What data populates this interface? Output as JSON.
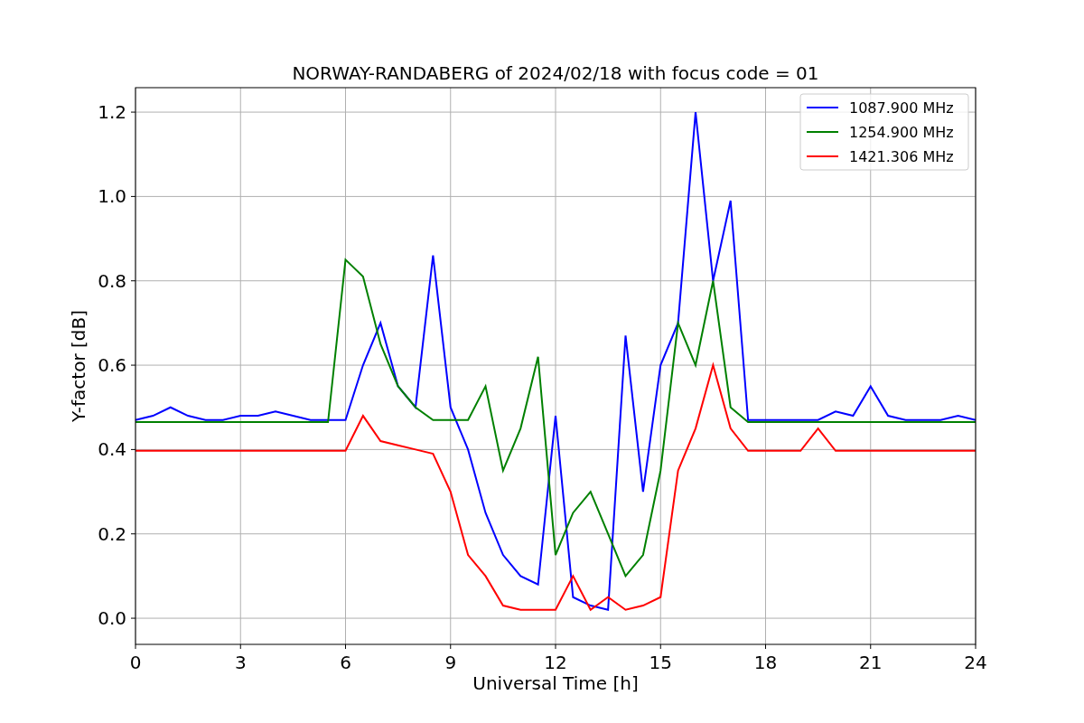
{
  "figure": {
    "chart_data": {
      "type": "line",
      "title": "NORWAY-RANDABERG of 2024/02/18 with focus code = 01",
      "xlabel": "Universal Time [h]",
      "ylabel": "Y-factor [dB]",
      "x": [
        0,
        0.5,
        1,
        1.5,
        2,
        2.5,
        3,
        3.5,
        4,
        4.5,
        5,
        5.5,
        6,
        6.5,
        7,
        7.5,
        8,
        8.5,
        9,
        9.5,
        10,
        10.5,
        11,
        11.5,
        12,
        12.5,
        13,
        13.5,
        14,
        14.5,
        15,
        15.5,
        16,
        16.5,
        17,
        17.5,
        18,
        18.5,
        19,
        19.5,
        20,
        20.5,
        21,
        21.5,
        22,
        22.5,
        23,
        23.5,
        24
      ],
      "series": [
        {
          "name": "1087.900 MHz",
          "color": "#0000ff",
          "values": [
            0.47,
            0.48,
            0.5,
            0.48,
            0.47,
            0.47,
            0.48,
            0.48,
            0.49,
            0.48,
            0.47,
            0.47,
            0.47,
            0.6,
            0.7,
            0.55,
            0.5,
            0.86,
            0.5,
            0.4,
            0.25,
            0.15,
            0.1,
            0.08,
            0.48,
            0.05,
            0.03,
            0.02,
            0.67,
            0.3,
            0.6,
            0.7,
            1.2,
            0.8,
            0.99,
            0.47,
            0.47,
            0.47,
            0.47,
            0.47,
            0.49,
            0.48,
            0.55,
            0.48,
            0.47,
            0.47,
            0.47,
            0.48,
            0.47
          ]
        },
        {
          "name": "1254.900 MHz",
          "color": "#008000",
          "values": [
            0.465,
            0.465,
            0.465,
            0.465,
            0.465,
            0.465,
            0.465,
            0.465,
            0.465,
            0.465,
            0.465,
            0.465,
            0.85,
            0.81,
            0.65,
            0.55,
            0.5,
            0.47,
            0.47,
            0.47,
            0.55,
            0.35,
            0.45,
            0.62,
            0.15,
            0.25,
            0.3,
            0.2,
            0.1,
            0.15,
            0.35,
            0.7,
            0.6,
            0.8,
            0.5,
            0.465,
            0.465,
            0.465,
            0.465,
            0.465,
            0.465,
            0.465,
            0.465,
            0.465,
            0.465,
            0.465,
            0.465,
            0.465,
            0.465
          ]
        },
        {
          "name": "1421.306 MHz",
          "color": "#ff0000",
          "values": [
            0.397,
            0.397,
            0.397,
            0.397,
            0.397,
            0.397,
            0.397,
            0.397,
            0.397,
            0.397,
            0.397,
            0.397,
            0.397,
            0.48,
            0.42,
            0.41,
            0.4,
            0.39,
            0.3,
            0.15,
            0.1,
            0.03,
            0.02,
            0.02,
            0.02,
            0.1,
            0.02,
            0.05,
            0.02,
            0.03,
            0.05,
            0.35,
            0.45,
            0.6,
            0.45,
            0.397,
            0.397,
            0.397,
            0.397,
            0.45,
            0.397,
            0.397,
            0.397,
            0.397,
            0.397,
            0.397,
            0.397,
            0.397,
            0.397
          ]
        }
      ],
      "grid": true,
      "legend": "upper right",
      "xlim": [
        0,
        24
      ],
      "ylim": [
        -0.062,
        1.258
      ],
      "xticks": [
        0,
        3,
        6,
        9,
        12,
        15,
        18,
        21,
        24
      ],
      "yticks": [
        {
          "value": 0,
          "label": "0.0"
        },
        {
          "value": 0.2,
          "label": "0.2"
        },
        {
          "value": 0.4,
          "label": "0.4"
        },
        {
          "value": 0.6,
          "label": "0.6"
        },
        {
          "value": 0.8,
          "label": "0.8"
        },
        {
          "value": 1.0,
          "label": "1.0"
        },
        {
          "value": 1.2,
          "label": "1.2"
        }
      ]
    }
  }
}
